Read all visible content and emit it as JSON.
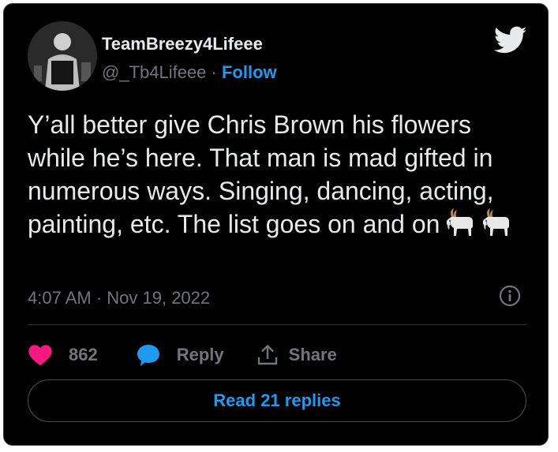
{
  "user": {
    "display_name": "TeamBreezy4Lifeee",
    "handle": "@_Tb4Lifeee",
    "separator": " · ",
    "follow_label": "Follow"
  },
  "tweet": {
    "text": "Y’all better give Chris Brown his flowers while he’s here. That man is mad gifted in numerous ways. Singing, dancing, acting, painting, etc. The list goes on and on",
    "emojis": [
      "goat-emoji",
      "goat-emoji"
    ],
    "timestamp": "4:07 AM · Nov 19, 2022"
  },
  "actions": {
    "like_count": "862",
    "reply_label": "Reply",
    "share_label": "Share"
  },
  "read_replies_label": "Read 21 replies",
  "icons": {
    "brand": "twitter-bird-icon",
    "info": "info-icon",
    "like": "heart-icon",
    "reply": "speech-bubble-icon",
    "share": "share-arrow-icon"
  },
  "colors": {
    "background": "#000000",
    "text": "#e7e9ea",
    "muted": "#71767b",
    "accent": "#1d9bf0",
    "like": "#f91880"
  }
}
